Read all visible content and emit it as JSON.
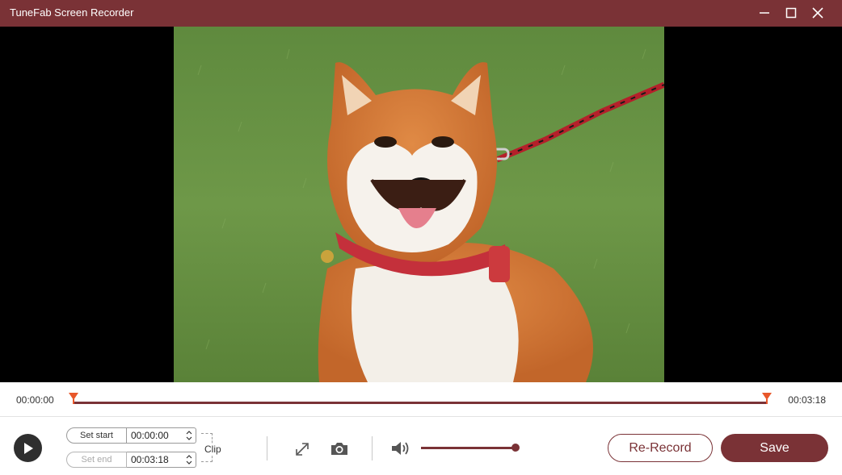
{
  "window": {
    "title": "TuneFab Screen Recorder",
    "controls": [
      "minimize",
      "maximize",
      "close"
    ]
  },
  "colors": {
    "accent": "#7a3236",
    "handle": "#e8572a",
    "video_background": "#000000"
  },
  "video": {
    "content": "photo of a shiba inu dog on a leash sitting on grass"
  },
  "timeline": {
    "current_time": "00:00:00",
    "total_time": "00:03:18",
    "progress_fraction": 0
  },
  "clip": {
    "set_start_label": "Set start",
    "start_value": "00:00:00",
    "set_end_label": "Set end",
    "end_value": "00:03:18",
    "clip_label": "Clip"
  },
  "tools": {
    "fullscreen_icon": "expand-arrows-icon",
    "snapshot_icon": "camera-icon",
    "volume_icon": "speaker-icon"
  },
  "volume": {
    "level_fraction": 1.0
  },
  "actions": {
    "rerecord_label": "Re-Record",
    "save_label": "Save"
  }
}
